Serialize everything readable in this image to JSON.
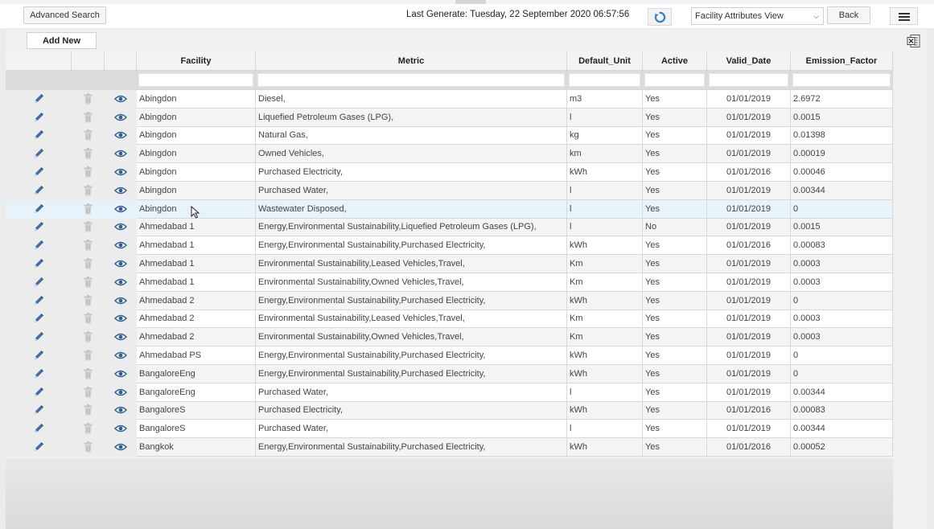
{
  "toolbar": {
    "advanced_search": "Advanced Search",
    "last_generate_label": "Last Generate:",
    "last_generate_value": "Tuesday, 22 September 2020 06:57:56",
    "view_select": "Facility Attributes View",
    "back": "Back"
  },
  "actions": {
    "add_new": "Add New"
  },
  "icons": {
    "edit": "pencil-icon",
    "delete": "trash-icon",
    "view": "eye-icon",
    "export": "excel-icon",
    "refresh": "refresh-icon",
    "menu": "hamburger-menu-icon"
  },
  "colors": {
    "selected_row": "#e6f3fb",
    "icon_blue": "#3f6fa3"
  },
  "table": {
    "headers": [
      "Facility",
      "Metric",
      "Default_Unit",
      "Active",
      "Valid_Date",
      "Emission_Factor"
    ],
    "rows": [
      [
        "Abingdon",
        "Diesel,",
        "m3",
        "Yes",
        "01/01/2019",
        "2.6972"
      ],
      [
        "Abingdon",
        "Liquefied Petroleum Gases (LPG),",
        "l",
        "Yes",
        "01/01/2019",
        "0.0015"
      ],
      [
        "Abingdon",
        "Natural Gas,",
        "kg",
        "Yes",
        "01/01/2019",
        "0.01398"
      ],
      [
        "Abingdon",
        "Owned Vehicles,",
        "km",
        "Yes",
        "01/01/2019",
        "0.00019"
      ],
      [
        "Abingdon",
        "Purchased Electricity,",
        "kWh",
        "Yes",
        "01/01/2016",
        "0.00046"
      ],
      [
        "Abingdon",
        "Purchased Water,",
        "l",
        "Yes",
        "01/01/2019",
        "0.00344"
      ],
      [
        "Abingdon",
        "Wastewater Disposed,",
        "l",
        "Yes",
        "01/01/2019",
        "0"
      ],
      [
        "Ahmedabad 1",
        "Energy,Environmental Sustainability,Liquefied Petroleum Gases (LPG),",
        "l",
        "No",
        "01/01/2019",
        "0.0015"
      ],
      [
        "Ahmedabad 1",
        "Energy,Environmental Sustainability,Purchased Electricity,",
        "kWh",
        "Yes",
        "01/01/2016",
        "0.00083"
      ],
      [
        "Ahmedabad 1",
        "Environmental Sustainability,Leased Vehicles,Travel,",
        "Km",
        "Yes",
        "01/01/2019",
        "0.0003"
      ],
      [
        "Ahmedabad 1",
        "Environmental Sustainability,Owned Vehicles,Travel,",
        "Km",
        "Yes",
        "01/01/2019",
        "0.0003"
      ],
      [
        "Ahmedabad 2",
        "Energy,Environmental Sustainability,Purchased Electricity,",
        "kWh",
        "Yes",
        "01/01/2019",
        "0"
      ],
      [
        "Ahmedabad 2",
        "Environmental Sustainability,Leased Vehicles,Travel,",
        "Km",
        "Yes",
        "01/01/2019",
        "0.0003"
      ],
      [
        "Ahmedabad 2",
        "Environmental Sustainability,Owned Vehicles,Travel,",
        "Km",
        "Yes",
        "01/01/2019",
        "0.0003"
      ],
      [
        "Ahmedabad PS",
        "Energy,Environmental Sustainability,Purchased Electricity,",
        "kWh",
        "Yes",
        "01/01/2019",
        "0"
      ],
      [
        "BangaloreEng",
        "Energy,Environmental Sustainability,Purchased Electricity,",
        "kWh",
        "Yes",
        "01/01/2019",
        "0"
      ],
      [
        "BangaloreEng",
        "Purchased Water,",
        "l",
        "Yes",
        "01/01/2019",
        "0.00344"
      ],
      [
        "BangaloreS",
        "Purchased Electricity,",
        "kWh",
        "Yes",
        "01/01/2016",
        "0.00083"
      ],
      [
        "BangaloreS",
        "Purchased Water,",
        "l",
        "Yes",
        "01/01/2019",
        "0.00344"
      ],
      [
        "Bangkok",
        "Energy,Environmental Sustainability,Purchased Electricity,",
        "kWh",
        "Yes",
        "01/01/2016",
        "0.00052"
      ]
    ],
    "selected_row": 6
  }
}
